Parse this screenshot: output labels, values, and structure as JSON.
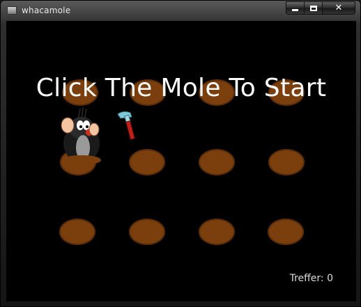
{
  "window": {
    "title": "whacamole",
    "buttons": [
      "minimize",
      "maximize",
      "close"
    ]
  },
  "game": {
    "start_message": "Click The Mole To Start",
    "score_label": "Treffer:",
    "score_value": "0",
    "holes": {
      "rows": 3,
      "columns": 4
    },
    "mole_position": {
      "row": 2,
      "column": 1
    },
    "colors": {
      "background": "#000000",
      "hole": "#7b3f0e",
      "text": "#ffffff"
    }
  }
}
